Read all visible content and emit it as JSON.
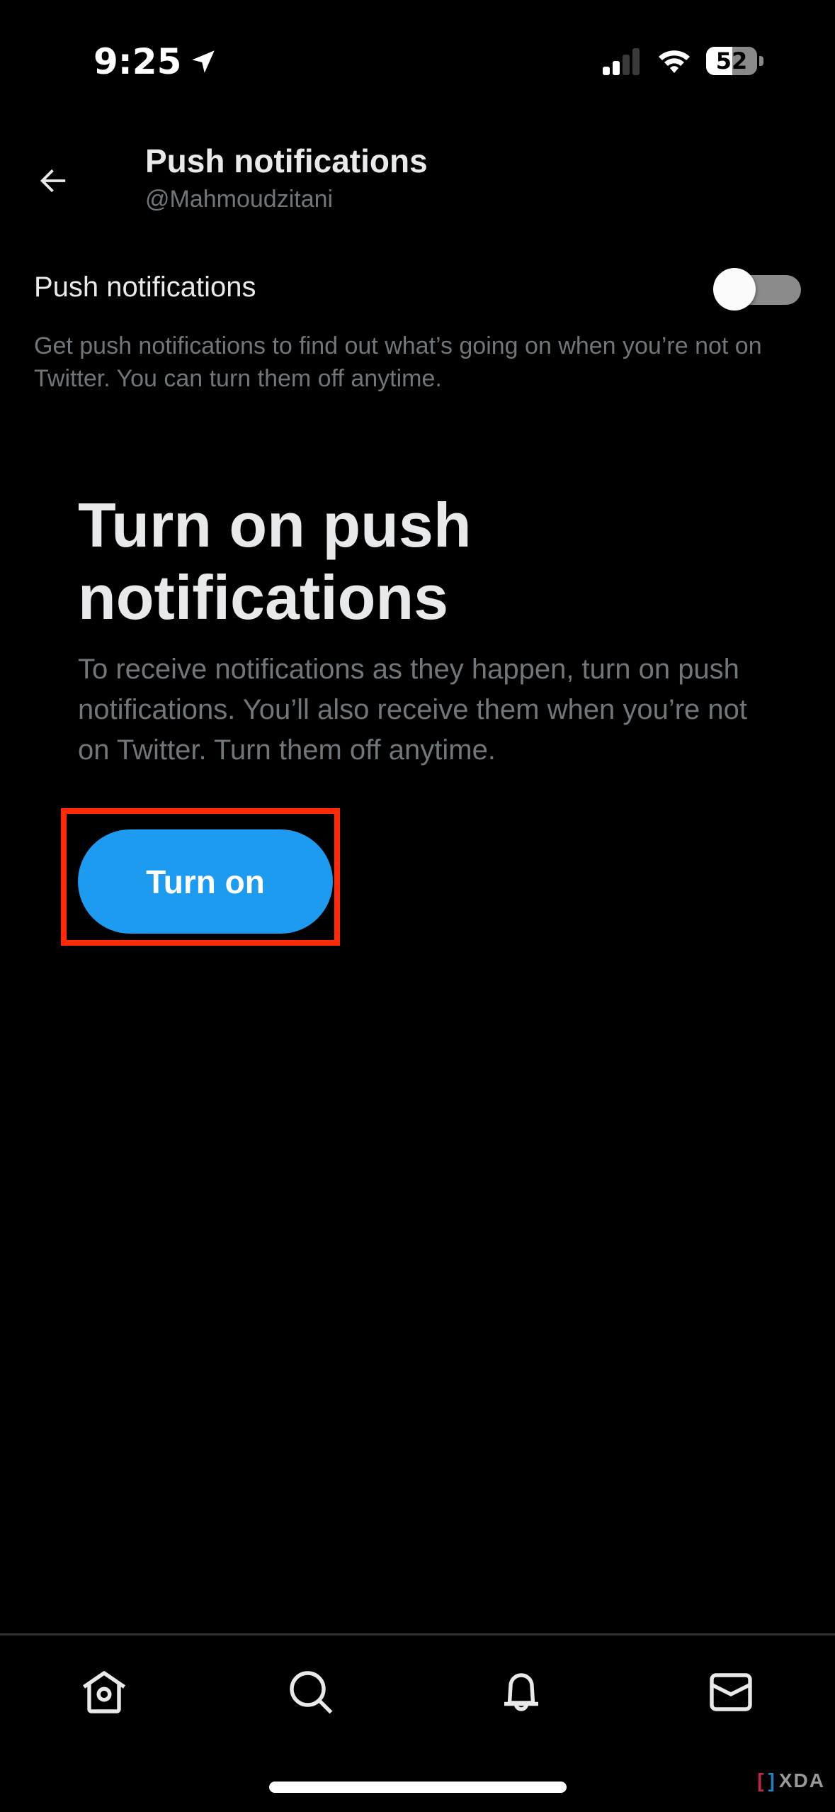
{
  "status_bar": {
    "time": "9:25",
    "battery_level": 52,
    "battery_text": "52",
    "signal_bars_active": 2,
    "signal_bars_total": 4,
    "icons": [
      "location-arrow-icon",
      "cellular-signal-icon",
      "wifi-icon",
      "battery-icon"
    ]
  },
  "header": {
    "back_icon": "arrow-left-icon",
    "title": "Push notifications",
    "subtitle": "@Mahmoudzitani"
  },
  "setting": {
    "label": "Push notifications",
    "toggle_on": false,
    "description": "Get push notifications to find out what’s going on when you’re not on Twitter. You can turn them off anytime."
  },
  "prompt": {
    "title": "Turn on push notifications",
    "body": "To receive notifications as they happen, turn on push notifications. You’ll also receive them when you’re not on Twitter. Turn them off anytime.",
    "button_label": "Turn on",
    "highlighted": true
  },
  "bottom_nav": {
    "items": [
      {
        "name": "home",
        "icon": "home-icon"
      },
      {
        "name": "search",
        "icon": "search-icon"
      },
      {
        "name": "notifications",
        "icon": "bell-icon"
      },
      {
        "name": "messages",
        "icon": "envelope-icon"
      }
    ]
  },
  "watermark": {
    "text": "XDA"
  },
  "colors": {
    "background": "#000000",
    "primary_text": "#e7e9ea",
    "secondary_text": "#71767b",
    "accent": "#1d9bf0",
    "highlight": "#ff2a0a",
    "toggle_track_off": "#8b8b8b",
    "divider": "#2f3336"
  }
}
